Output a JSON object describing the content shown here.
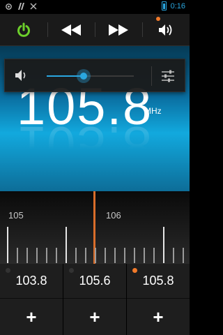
{
  "status_bar": {
    "icons": [
      "gps-icon",
      "signal-icon",
      "scissors-icon"
    ],
    "time": "0:16",
    "accent_color": "#2aa7e0"
  },
  "controls": {
    "power_color": "#6ccf2b",
    "accent_color": "#f27a2a"
  },
  "frequency": {
    "value": "105.8",
    "unit": "MHz"
  },
  "volume": {
    "level_fraction": 0.42
  },
  "tuner": {
    "labels": [
      "105",
      "106"
    ],
    "needle_color": "#d96d2a"
  },
  "presets": [
    {
      "freq": "103.8",
      "active": false,
      "add_label": "+"
    },
    {
      "freq": "105.6",
      "active": false,
      "add_label": "+"
    },
    {
      "freq": "105.8",
      "active": true,
      "add_label": "+"
    }
  ]
}
